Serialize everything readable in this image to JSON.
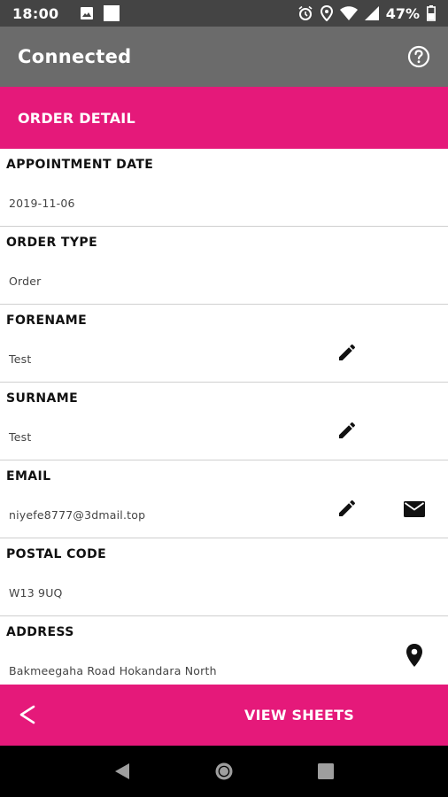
{
  "status_bar": {
    "time": "18:00",
    "battery": "47%"
  },
  "app_bar": {
    "title": "Connected"
  },
  "section": {
    "title": "ORDER DETAIL"
  },
  "fields": [
    {
      "label": "APPOINTMENT DATE",
      "value": "2019-11-06"
    },
    {
      "label": "ORDER TYPE",
      "value": "Order"
    },
    {
      "label": "FORENAME",
      "value": "Test"
    },
    {
      "label": "SURNAME",
      "value": "Test"
    },
    {
      "label": "EMAIL",
      "value": "niyefe8777@3dmail.top"
    },
    {
      "label": "POSTAL CODE",
      "value": "W13 9UQ"
    },
    {
      "label": "ADDRESS",
      "value": "Bakmeegaha Road Hokandara North"
    }
  ],
  "bottom_bar": {
    "back_glyph": "<",
    "view_sheets_label": "VIEW SHEETS"
  },
  "colors": {
    "accent": "#e5197a",
    "app_bar": "#6b6b6b",
    "status_bar": "#444444"
  },
  "icons": {
    "help": "help-circle-icon",
    "edit": "pencil-icon",
    "mail": "envelope-icon",
    "location": "map-pin-icon"
  }
}
